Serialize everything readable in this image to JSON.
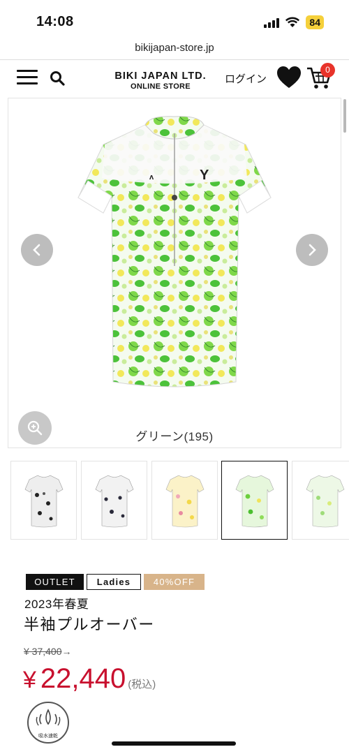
{
  "status_bar": {
    "time": "14:08",
    "battery": "84"
  },
  "browser": {
    "url": "bikijapan-store.jp"
  },
  "header": {
    "logo_main": "BIKI JAPAN LTD.",
    "logo_sub": "ONLINE STORE",
    "login_label": "ログイン",
    "cart_count": "0"
  },
  "gallery": {
    "color_caption": "グリーン(195)",
    "thumbnails": [
      {
        "color": "white-black"
      },
      {
        "color": "white-navy"
      },
      {
        "color": "yellow-pink"
      },
      {
        "color": "green",
        "active": true
      },
      {
        "color": "light-green"
      }
    ]
  },
  "product": {
    "badges": {
      "outlet": "OUTLET",
      "ladies": "Ladies",
      "discount": "40%OFF"
    },
    "season": "2023年春夏",
    "name": "半袖プルオーバー",
    "original_price": "¥ 37,400",
    "price_currency": "¥",
    "price": "22,440",
    "tax_label": "(税込)",
    "feature_label": "吸水速乾"
  },
  "colors": {
    "accent_red": "#c8102e",
    "discount_badge": "#d8b48a",
    "cart_badge": "#e8332a"
  }
}
